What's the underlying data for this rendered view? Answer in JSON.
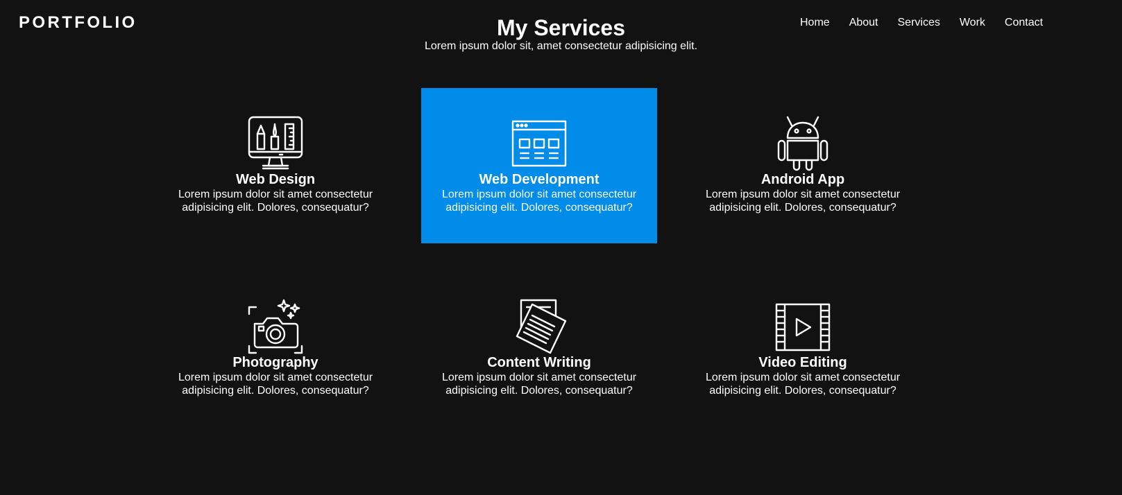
{
  "header": {
    "logo": "PORTFOLIO",
    "nav": [
      "Home",
      "About",
      "Services",
      "Work",
      "Contact"
    ]
  },
  "section": {
    "title": "My Services",
    "subtitle": "Lorem ipsum dolor sit, amet consectetur adipisicing elit."
  },
  "accent_color": "#008ce8",
  "background_color": "#121212",
  "services": [
    {
      "title": "Web Design",
      "text": "Lorem ipsum dolor sit amet consectetur adipisicing elit. Dolores, consequatur?",
      "icon": "monitor-design-tools-icon",
      "active": false
    },
    {
      "title": "Web Development",
      "text": "Lorem ipsum dolor sit amet consectetur adipisicing elit. Dolores, consequatur?",
      "icon": "browser-window-icon",
      "active": true
    },
    {
      "title": "Android App",
      "text": "Lorem ipsum dolor sit amet consectetur adipisicing elit. Dolores, consequatur?",
      "icon": "android-robot-icon",
      "active": false
    },
    {
      "title": "Photography",
      "text": "Lorem ipsum dolor sit amet consectetur adipisicing elit. Dolores, consequatur?",
      "icon": "camera-icon",
      "active": false
    },
    {
      "title": "Content Writing",
      "text": "Lorem ipsum dolor sit amet consectetur adipisicing elit. Dolores, consequatur?",
      "icon": "documents-icon",
      "active": false
    },
    {
      "title": "Video Editing",
      "text": "Lorem ipsum dolor sit amet consectetur adipisicing elit. Dolores, consequatur?",
      "icon": "film-play-icon",
      "active": false
    }
  ]
}
